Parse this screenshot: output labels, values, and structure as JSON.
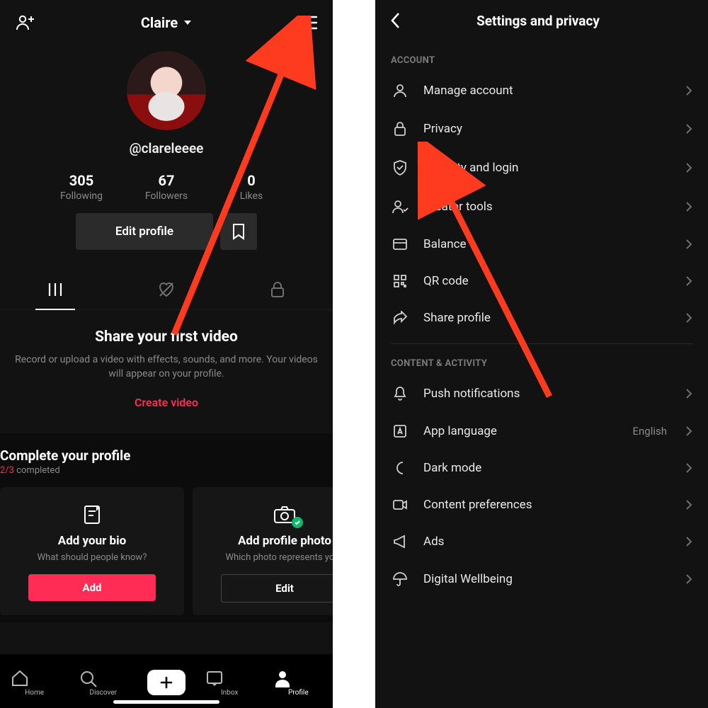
{
  "left": {
    "display_name": "Claire",
    "handle": "@clareleeee",
    "stats": {
      "following": {
        "count": "305",
        "label": "Following"
      },
      "followers": {
        "count": "67",
        "label": "Followers"
      },
      "likes": {
        "count": "0",
        "label": "Likes"
      }
    },
    "edit_profile": "Edit profile",
    "empty_state": {
      "title": "Share your first video",
      "subtitle": "Record or upload a video with effects, sounds, and more. Your videos will appear on your profile.",
      "cta": "Create video"
    },
    "complete": {
      "title": "Complete your profile",
      "done": "2/3",
      "done_suffix": " completed",
      "cards": [
        {
          "title": "Add your bio",
          "sub": "What should people know?",
          "btn": "Add"
        },
        {
          "title": "Add profile photo",
          "sub": "Which photo represents you?",
          "btn": "Edit"
        }
      ]
    },
    "nav": {
      "home": "Home",
      "discover": "Discover",
      "inbox": "Inbox",
      "profile": "Profile"
    }
  },
  "right": {
    "title": "Settings and privacy",
    "sections": {
      "account": {
        "header": "ACCOUNT",
        "items": {
          "manage": "Manage account",
          "privacy": "Privacy",
          "security": "Security and login",
          "creator": "Creator tools",
          "balance": "Balance",
          "qr": "QR code",
          "share": "Share profile"
        }
      },
      "content": {
        "header": "CONTENT & ACTIVITY",
        "items": {
          "push": "Push notifications",
          "lang": "App language",
          "lang_value": "English",
          "dark": "Dark mode",
          "pref": "Content preferences",
          "ads": "Ads",
          "wellbeing": "Digital Wellbeing"
        }
      }
    }
  }
}
